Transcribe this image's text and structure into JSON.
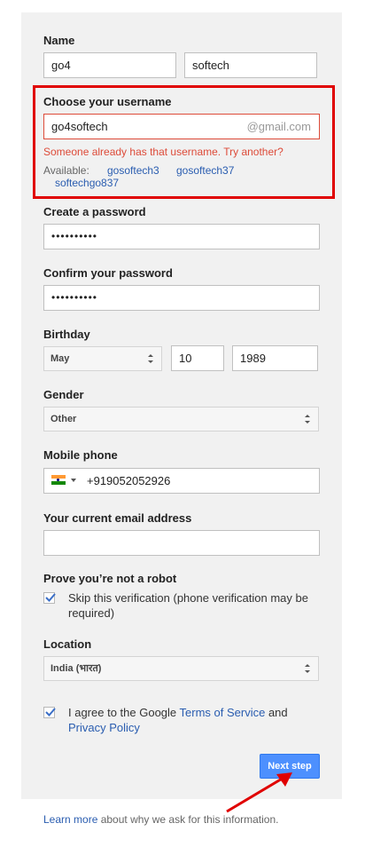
{
  "name": {
    "label": "Name",
    "first": "go4",
    "last": "softech"
  },
  "username": {
    "label": "Choose your username",
    "value": "go4softech",
    "suffix": "@gmail.com",
    "error": "Someone already has that username. Try another?",
    "available_label": "Available:",
    "suggestions": [
      "gosoftech3",
      "gosoftech37",
      "softechgo837"
    ]
  },
  "password": {
    "label": "Create a password",
    "value": "••••••••••"
  },
  "confirm": {
    "label": "Confirm your password",
    "value": "••••••••••"
  },
  "birthday": {
    "label": "Birthday",
    "month": "May",
    "day": "10",
    "year": "1989"
  },
  "gender": {
    "label": "Gender",
    "value": "Other"
  },
  "mobile": {
    "label": "Mobile phone",
    "value": "+919052052926",
    "flag_icon": "india-flag-icon"
  },
  "email": {
    "label": "Your current email address",
    "value": ""
  },
  "robot": {
    "label": "Prove you’re not a robot",
    "skip_text_1": "Skip this verification (phone verification may be",
    "skip_text_2": "required)",
    "checked": true
  },
  "location": {
    "label": "Location",
    "value": "India (भारत)"
  },
  "terms": {
    "text_1": "I agree to the Google ",
    "terms_link": "Terms of Service",
    "text_and": " and",
    "privacy_link": "Privacy Policy",
    "checked": true
  },
  "next_button": "Next step",
  "footer": {
    "learn_more": "Learn more",
    "rest": " about why we ask for this information."
  },
  "colors": {
    "error": "#dd4b39",
    "highlight_box": "#e00000",
    "button": "#4d90fe",
    "link": "#2a5db0"
  }
}
